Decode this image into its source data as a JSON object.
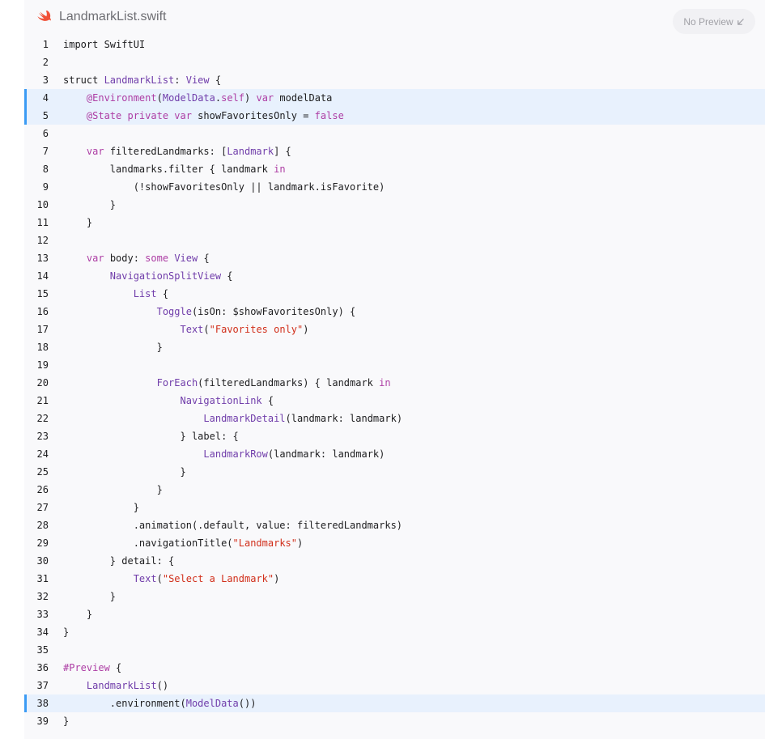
{
  "header": {
    "filename": "LandmarkList.swift",
    "preview_button": "No Preview",
    "preview_icon": "arrow-down-left-icon"
  },
  "colors": {
    "keyword": "#ad3da4",
    "type": "#703daa",
    "string": "#d12f1b",
    "plain": "#1d1d1f",
    "highlight_bg": "#e8f1fd",
    "highlight_bar": "#3b9bf4",
    "swift_logo": "#f05138"
  },
  "code": {
    "highlighted_lines": [
      4,
      5,
      38
    ],
    "lines": [
      [
        [
          "p",
          "import SwiftUI"
        ]
      ],
      [],
      [
        [
          "p",
          "struct "
        ],
        [
          "t",
          "LandmarkList"
        ],
        [
          "p",
          ": "
        ],
        [
          "t",
          "View"
        ],
        [
          "p",
          " {"
        ]
      ],
      [
        [
          "p",
          "    "
        ],
        [
          "k",
          "@Environment"
        ],
        [
          "p",
          "("
        ],
        [
          "t",
          "ModelData"
        ],
        [
          "p",
          "."
        ],
        [
          "k",
          "self"
        ],
        [
          "p",
          ") "
        ],
        [
          "k",
          "var"
        ],
        [
          "p",
          " modelData"
        ]
      ],
      [
        [
          "p",
          "    "
        ],
        [
          "k",
          "@State private var"
        ],
        [
          "p",
          " showFavoritesOnly = "
        ],
        [
          "k",
          "false"
        ]
      ],
      [],
      [
        [
          "p",
          "    "
        ],
        [
          "k",
          "var"
        ],
        [
          "p",
          " filteredLandmarks: ["
        ],
        [
          "t",
          "Landmark"
        ],
        [
          "p",
          "] {"
        ]
      ],
      [
        [
          "p",
          "        landmarks.filter { landmark "
        ],
        [
          "k",
          "in"
        ]
      ],
      [
        [
          "p",
          "            (!showFavoritesOnly || landmark.isFavorite)"
        ]
      ],
      [
        [
          "p",
          "        }"
        ]
      ],
      [
        [
          "p",
          "    }"
        ]
      ],
      [],
      [
        [
          "p",
          "    "
        ],
        [
          "k",
          "var"
        ],
        [
          "p",
          " body: "
        ],
        [
          "k",
          "some"
        ],
        [
          "p",
          " "
        ],
        [
          "t",
          "View"
        ],
        [
          "p",
          " {"
        ]
      ],
      [
        [
          "p",
          "        "
        ],
        [
          "t",
          "NavigationSplitView"
        ],
        [
          "p",
          " {"
        ]
      ],
      [
        [
          "p",
          "            "
        ],
        [
          "t",
          "List"
        ],
        [
          "p",
          " {"
        ]
      ],
      [
        [
          "p",
          "                "
        ],
        [
          "t",
          "Toggle"
        ],
        [
          "p",
          "(isOn: $showFavoritesOnly) {"
        ]
      ],
      [
        [
          "p",
          "                    "
        ],
        [
          "t",
          "Text"
        ],
        [
          "p",
          "("
        ],
        [
          "s",
          "\"Favorites only\""
        ],
        [
          "p",
          ")"
        ]
      ],
      [
        [
          "p",
          "                }"
        ]
      ],
      [],
      [
        [
          "p",
          "                "
        ],
        [
          "t",
          "ForEach"
        ],
        [
          "p",
          "(filteredLandmarks) { landmark "
        ],
        [
          "k",
          "in"
        ]
      ],
      [
        [
          "p",
          "                    "
        ],
        [
          "t",
          "NavigationLink"
        ],
        [
          "p",
          " {"
        ]
      ],
      [
        [
          "p",
          "                        "
        ],
        [
          "t",
          "LandmarkDetail"
        ],
        [
          "p",
          "(landmark: landmark)"
        ]
      ],
      [
        [
          "p",
          "                    } label: {"
        ]
      ],
      [
        [
          "p",
          "                        "
        ],
        [
          "t",
          "LandmarkRow"
        ],
        [
          "p",
          "(landmark: landmark)"
        ]
      ],
      [
        [
          "p",
          "                    }"
        ]
      ],
      [
        [
          "p",
          "                }"
        ]
      ],
      [
        [
          "p",
          "            }"
        ]
      ],
      [
        [
          "p",
          "            .animation(.default, value: filteredLandmarks)"
        ]
      ],
      [
        [
          "p",
          "            .navigationTitle("
        ],
        [
          "s",
          "\"Landmarks\""
        ],
        [
          "p",
          ")"
        ]
      ],
      [
        [
          "p",
          "        } detail: {"
        ]
      ],
      [
        [
          "p",
          "            "
        ],
        [
          "t",
          "Text"
        ],
        [
          "p",
          "("
        ],
        [
          "s",
          "\"Select a Landmark\""
        ],
        [
          "p",
          ")"
        ]
      ],
      [
        [
          "p",
          "        }"
        ]
      ],
      [
        [
          "p",
          "    }"
        ]
      ],
      [
        [
          "p",
          "}"
        ]
      ],
      [],
      [
        [
          "k",
          "#Preview"
        ],
        [
          "p",
          " {"
        ]
      ],
      [
        [
          "p",
          "    "
        ],
        [
          "t",
          "LandmarkList"
        ],
        [
          "p",
          "()"
        ]
      ],
      [
        [
          "p",
          "        .environment("
        ],
        [
          "t",
          "ModelData"
        ],
        [
          "p",
          "())"
        ]
      ],
      [
        [
          "p",
          "}"
        ]
      ]
    ]
  }
}
